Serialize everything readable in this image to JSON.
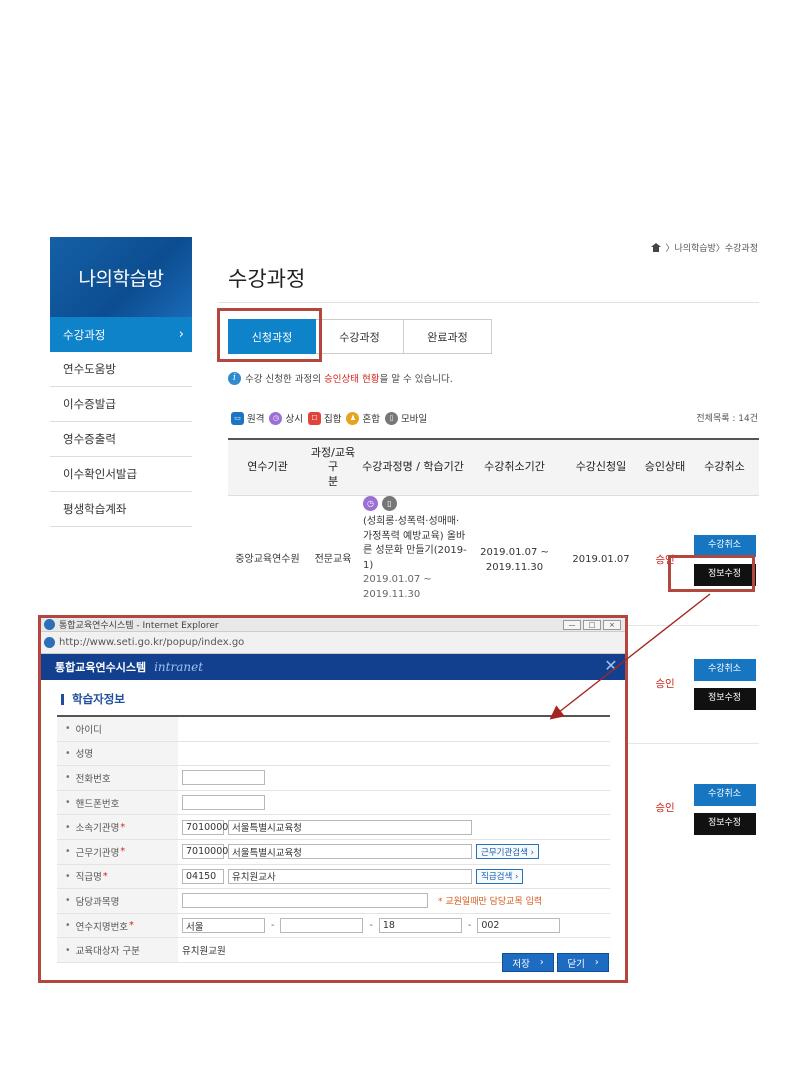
{
  "sidebar": {
    "title": "나의학습방",
    "items": [
      {
        "label": "수강과정"
      },
      {
        "label": "연수도움방"
      },
      {
        "label": "이수증발급"
      },
      {
        "label": "영수증출력"
      },
      {
        "label": "이수확인서발급"
      },
      {
        "label": "평생학습계좌"
      }
    ]
  },
  "breadcrumb": {
    "text": "〉나의학습방〉수강과정"
  },
  "page_title": "수강과정",
  "tabs": [
    "신청과정",
    "수강과정",
    "완료과정"
  ],
  "info": {
    "pre": "수강 신청한 과정의 ",
    "highlight": "승인상태 현황",
    "post": "을 알 수 있습니다."
  },
  "legend": [
    {
      "label": "원격",
      "color": "#1d74c2",
      "icon": "monitor-icon"
    },
    {
      "label": "상시",
      "color": "#9c6fd6",
      "icon": "clock-icon"
    },
    {
      "label": "집합",
      "color": "#e0443b",
      "icon": "group-icon"
    },
    {
      "label": "혼합",
      "color": "#e6a31d",
      "icon": "mixed-icon"
    },
    {
      "label": "모바일",
      "color": "#777777",
      "icon": "mobile-icon"
    }
  ],
  "total": "전체목록 : 14건",
  "table": {
    "headers": [
      "연수기관",
      "과정/교육구분",
      "수강과정명 / 학습기간",
      "수강취소기간",
      "수강신청일",
      "승인상태",
      "수강취소"
    ],
    "header_lines": {
      "c2": [
        "과정/교육구",
        "분"
      ]
    },
    "rows": [
      {
        "org": "중앙교육연수원",
        "type": "전문교육",
        "course": "(성희롱·성폭력·성매매·가정폭력 예방교육) 올바른 성문화 만들기(2019-1)",
        "period": "2019.01.07 ~ 2019.11.30",
        "cancel_period": "2019.01.07 ~ 2019.11.30",
        "applied": "2019.01.07",
        "status": "승인",
        "cancel_btn": "수강취소",
        "edit_btn": "정보수정"
      },
      {
        "status": "승인",
        "cancel_btn": "수강취소",
        "edit_btn": "정보수정"
      },
      {
        "status": "승인",
        "cancel_btn": "수강취소",
        "edit_btn": "정보수정"
      }
    ]
  },
  "popup": {
    "window_title": "통합교육연수시스템 - Internet Explorer",
    "url": "http://www.seti.go.kr/popup/index.go",
    "brand": "통합교육연수시스템",
    "brand_sub": "intranet",
    "section_title": "학습자정보",
    "fields": {
      "id_label": "아이디",
      "name_label": "성명",
      "phone_label": "전화번호",
      "mobile_label": "핸드폰번호",
      "org_label": "소속기관명",
      "org_code": "7010000",
      "org_name": "서울특별시교육청",
      "work_label": "근무기관명",
      "work_code": "7010000",
      "work_name": "서울특별시교육청",
      "work_btn": "근무기관검색 ›",
      "rank_label": "직급명",
      "rank_code": "04150",
      "rank_name": "유치원교사",
      "rank_btn": "직급검색 ›",
      "dept_label": "담당과목명",
      "dept_note": "* 교원일때만 담당교목 입력",
      "reg_label": "연수지명번호",
      "reg1": "서울",
      "reg2": "",
      "reg3": "18",
      "reg4": "002",
      "target_label": "교육대상자 구분",
      "target_value": "유치원교원"
    },
    "save_btn": "저장",
    "close_btn": "닫기"
  }
}
